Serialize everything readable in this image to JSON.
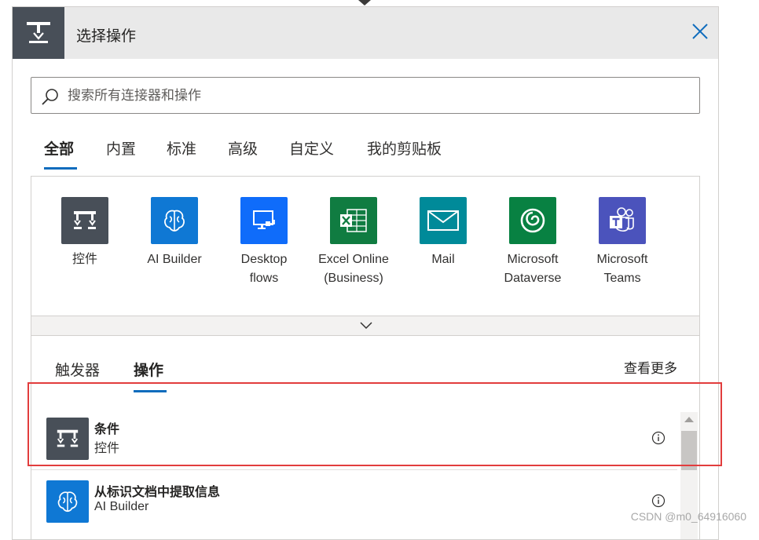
{
  "header": {
    "title": "选择操作",
    "icon": "control-icon"
  },
  "search": {
    "placeholder": "搜索所有连接器和操作",
    "value": ""
  },
  "tabs": [
    {
      "label": "全部",
      "active": true
    },
    {
      "label": "内置",
      "active": false
    },
    {
      "label": "标准",
      "active": false
    },
    {
      "label": "高级",
      "active": false
    },
    {
      "label": "自定义",
      "active": false
    },
    {
      "label": "我的剪贴板",
      "active": false
    }
  ],
  "connectors": [
    {
      "line1": "控件",
      "line2": "",
      "color": "#484f58",
      "icon": "control-icon"
    },
    {
      "line1": "AI Builder",
      "line2": "",
      "color": "#0f78d4",
      "icon": "brain-icon"
    },
    {
      "line1": "Desktop",
      "line2": "flows",
      "color": "#0f6cfa",
      "icon": "desktop-flow-icon"
    },
    {
      "line1": "Excel Online",
      "line2": "(Business)",
      "color": "#107c41",
      "icon": "excel-icon"
    },
    {
      "line1": "Mail",
      "line2": "",
      "color": "#008a99",
      "icon": "mail-icon"
    },
    {
      "line1": "Microsoft",
      "line2": "Dataverse",
      "color": "#088142",
      "icon": "dataverse-icon"
    },
    {
      "line1": "Microsoft",
      "line2": "Teams",
      "color": "#4b53bc",
      "icon": "teams-icon"
    }
  ],
  "subtabs": [
    {
      "label": "触发器",
      "active": false
    },
    {
      "label": "操作",
      "active": true
    }
  ],
  "see_more": "查看更多",
  "operations": [
    {
      "title": "条件",
      "subtitle": "控件",
      "color": "#484f58",
      "icon": "control-icon"
    },
    {
      "title": "从标识文档中提取信息",
      "subtitle": "AI Builder",
      "color": "#0f78d4",
      "icon": "brain-icon"
    }
  ],
  "watermark": "CSDN @m0_64916060"
}
